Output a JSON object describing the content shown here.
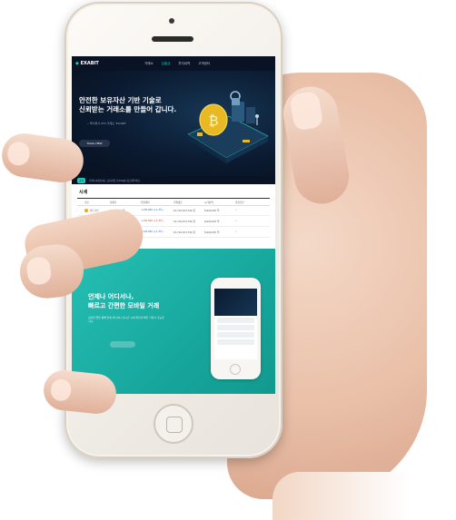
{
  "site": {
    "logo": "EXABIT",
    "nav": [
      "거래소",
      "입출금",
      "투자내역",
      "고객센터"
    ],
    "active_nav_index": 1
  },
  "hero": {
    "title_line1": "안전한 보유자산 기반 기술로",
    "title_line2": "신뢰받는 거래소를 만들어 갑니다.",
    "subtitle": "— 투식회사 XTS 거래소 'EXABIT'",
    "button_label": "Trade VIEW"
  },
  "notice": {
    "tag": "공지",
    "text": "거래소이용안내는 공지사항 및 FAQ를 참고해주세요."
  },
  "market": {
    "title": "시세",
    "columns": [
      "코인",
      "현재가",
      "전일대비",
      "거래대금",
      "시가총액",
      "관심코인"
    ],
    "rows": [
      {
        "coin": "비트코인",
        "price": "1,005,000 원",
        "change": "+105,000 (+1.3%)",
        "volume": "15,710,673,790 원",
        "cap": "8,620,670 억"
      },
      {
        "coin": "이더리움",
        "price": "1,005,000 원",
        "change": "+105,000 (+1.3%)",
        "volume": "15,710,673,790 원",
        "cap": "8,620,670 억"
      },
      {
        "coin": "리플코인",
        "price": "1,005,000 원",
        "change": "+105,000 (+1.3%)",
        "volume": "15,710,673,790 원",
        "cap": "8,620,670 억"
      }
    ]
  },
  "promo": {
    "title_line1": "언제나 어디서나,",
    "title_line2": "빠르고 간편한 모바일 거래",
    "description": "모바일 앱을 통해 언제 어디서나 실시간 시세 확인과 빠른 거래가 가능합니다."
  },
  "colors": {
    "accent": "#1ad1b5",
    "promo_bg": "#17a79d",
    "hero_bg": "#0b1a30"
  }
}
